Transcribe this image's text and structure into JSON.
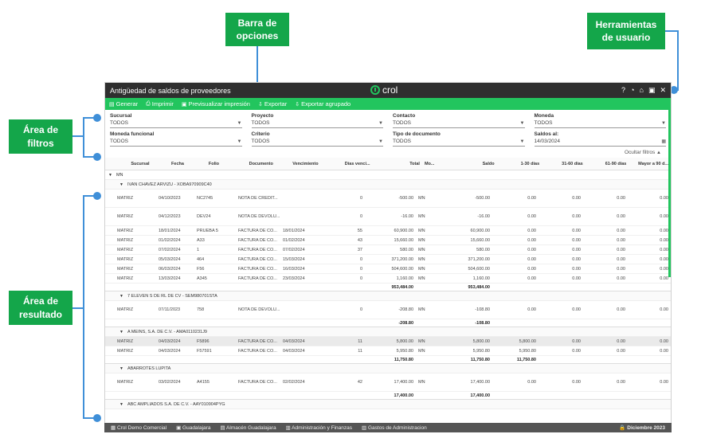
{
  "annotations": {
    "barra": "Barra de\nopciones",
    "herramientas": "Herramientas\nde usuario",
    "filtros": "Área de\nfiltros",
    "resultado": "Área de\nresultado"
  },
  "window": {
    "title": "Antigüedad de saldos de proveedores",
    "logo_text": "crol",
    "tools": [
      "?",
      "◔",
      "⌂",
      "▣",
      "✕"
    ]
  },
  "toolbar": {
    "items": [
      {
        "icon": "▤",
        "label": "Generar"
      },
      {
        "icon": "⎙",
        "label": "Imprimir"
      },
      {
        "icon": "▣",
        "label": "Previsualizar impresión"
      },
      {
        "icon": "⇩",
        "label": "Exportar"
      },
      {
        "icon": "⇩",
        "label": "Exportar agrupado"
      }
    ]
  },
  "filters": {
    "row1": [
      {
        "label": "Sucursal",
        "value": "TODOS"
      },
      {
        "label": "Proyecto",
        "value": "TODOS"
      },
      {
        "label": "Contacto",
        "value": "TODOS"
      },
      {
        "label": "Moneda",
        "value": "TODOS"
      }
    ],
    "row2": [
      {
        "label": "Moneda funcional",
        "value": "TODOS"
      },
      {
        "label": "Criterio",
        "value": "TODOS"
      },
      {
        "label": "Tipo de documento",
        "value": "TODOS"
      },
      {
        "label": "Saldos al:",
        "value": "14/03/2024"
      }
    ],
    "hide_label": "Ocultar filtros"
  },
  "grid": {
    "columns": [
      "Sucursal",
      "Fecha",
      "Folio",
      "Documento",
      "Vencimiento",
      "Días venci...",
      "Total",
      "Mo...",
      "Saldo",
      "1-30 días",
      "31-60 días",
      "61-90 días",
      "Mayor a 90 d..."
    ],
    "currency_group": "MN",
    "groups": [
      {
        "name": "IVAN CHAVEZ ARVIZU - XOBA970909C40",
        "rows": [
          {
            "tall": true,
            "cells": [
              "MATRIZ",
              "04/10/2023",
              "NC2745",
              "NOTA DE CRÉDIT...",
              "",
              "0",
              "-500.00",
              "MN",
              "-500.00",
              "0.00",
              "0.00",
              "0.00",
              "0.00"
            ]
          },
          {
            "tall": true,
            "cells": [
              "MATRIZ",
              "04/12/2023",
              "DEV24",
              "NOTA DE DEVOLU...",
              "",
              "0",
              "-16.00",
              "MN",
              "-16.00",
              "0.00",
              "0.00",
              "0.00",
              "0.00"
            ]
          },
          {
            "cells": [
              "MATRIZ",
              "18/01/2024",
              "PRUEBA 5",
              "FACTURA DE CO...",
              "18/01/2024",
              "55",
              "60,900.00",
              "MN",
              "60,900.00",
              "0.00",
              "0.00",
              "0.00",
              "0.00"
            ]
          },
          {
            "cells": [
              "MATRIZ",
              "01/02/2024",
              "A33",
              "FACTURA DE CO...",
              "01/02/2024",
              "43",
              "15,660.00",
              "MN",
              "15,660.00",
              "0.00",
              "0.00",
              "0.00",
              "0.00"
            ]
          },
          {
            "cells": [
              "MATRIZ",
              "07/02/2024",
              "1",
              "FACTURA DE CO...",
              "07/02/2024",
              "37",
              "580.00",
              "MN",
              "580.00",
              "0.00",
              "0.00",
              "0.00",
              "0.00"
            ]
          },
          {
            "cells": [
              "MATRIZ",
              "05/03/2024",
              "464",
              "FACTURA DE CO...",
              "15/03/2024",
              "0",
              "371,200.00",
              "MN",
              "371,200.00",
              "0.00",
              "0.00",
              "0.00",
              "0.00"
            ]
          },
          {
            "cells": [
              "MATRIZ",
              "06/03/2024",
              "F56",
              "FACTURA DE CO...",
              "16/03/2024",
              "0",
              "504,600.00",
              "MN",
              "504,600.00",
              "0.00",
              "0.00",
              "0.00",
              "0.00"
            ]
          },
          {
            "cells": [
              "MATRIZ",
              "13/03/2024",
              "A345",
              "FACTURA DE CO...",
              "23/03/2024",
              "0",
              "1,160.00",
              "MN",
              "1,160.00",
              "0.00",
              "0.00",
              "0.00",
              "0.00"
            ]
          }
        ],
        "total": "953,484.00",
        "saldo": "953,484.00"
      },
      {
        "name": "7 ELEVEN S DE RL DE CV - SEM980701STA",
        "rows": [
          {
            "tall": true,
            "cells": [
              "MATRIZ",
              "07/11/2023",
              "758",
              "NOTA DE DEVOLU...",
              "",
              "0",
              "-208.80",
              "MN",
              "-108.80",
              "0.00",
              "0.00",
              "0.00",
              "0.00"
            ]
          }
        ],
        "total": "-208.80",
        "saldo": "-108.80"
      },
      {
        "name": "A MEINS, S.A. DE C.V. - AMA0110231J9",
        "rows": [
          {
            "sel": true,
            "cells": [
              "MATRIZ",
              "04/03/2024",
              "F5896",
              "FACTURA DE CO...",
              "04/03/2024",
              "11",
              "5,800.00",
              "MN",
              "5,800.00",
              "5,800.00",
              "0.00",
              "0.00",
              "0.00"
            ]
          },
          {
            "cells": [
              "MATRIZ",
              "04/03/2024",
              "F57591",
              "FACTURA DE CO...",
              "04/03/2024",
              "11",
              "5,950.80",
              "MN",
              "5,950.80",
              "5,950.80",
              "0.00",
              "0.00",
              "0.00"
            ]
          }
        ],
        "total": "11,750.80",
        "saldo": "11,750.80",
        "b1": "11,750.80"
      },
      {
        "name": "ABARROTES LUPITA",
        "rows": [
          {
            "tall": true,
            "cells": [
              "MATRIZ",
              "03/02/2024",
              "A4155",
              "FACTURA DE CO...",
              "02/02/2024",
              "42",
              "17,400.00",
              "MN",
              "17,400.00",
              "0.00",
              "0.00",
              "0.00",
              "0.00"
            ]
          }
        ],
        "total": "17,400.00",
        "saldo": "17,400.00"
      }
    ],
    "next_group": "ABC AMPLIADOS S.A. DE C.V. - AAY010904PYG"
  },
  "statusbar": {
    "items": [
      "Crol Demo Comercial",
      "Guadalajara",
      "Almacén Guadalajara",
      "Administración y Finanzas",
      "Gastos de Administracion"
    ],
    "period": "Diciembre 2023"
  },
  "colors": {
    "accent": "#22c55e",
    "callout": "#14a64a",
    "line": "#3f8fd8",
    "titlebar": "#2f2f2f"
  }
}
